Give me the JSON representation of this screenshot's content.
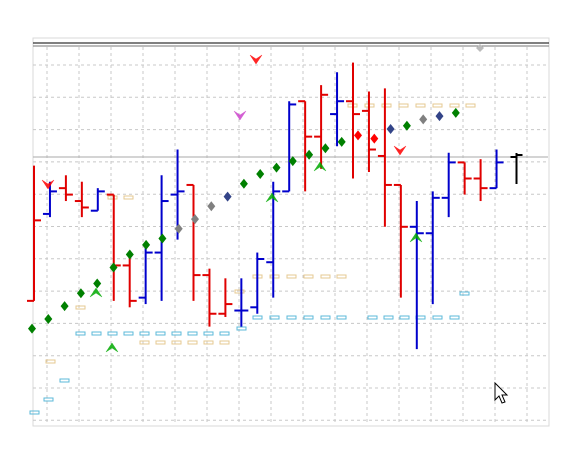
{
  "chart_data": {
    "type": "ohlc",
    "grid": true,
    "ylim": [
      0,
      100
    ],
    "x": [
      1,
      2,
      3,
      4,
      5,
      6,
      7,
      8,
      9,
      10,
      11,
      12,
      13,
      14,
      15,
      16,
      17,
      18,
      19,
      20,
      21,
      22,
      23,
      24,
      25,
      26,
      27,
      28,
      29,
      30
    ],
    "bars": [
      {
        "o": 37,
        "h": 79,
        "l": 62,
        "c": 62,
        "color": "red"
      },
      {
        "o": 64,
        "h": 74,
        "l": 63,
        "c": 71,
        "color": "blue"
      },
      {
        "o": 72,
        "h": 76,
        "l": 68,
        "c": 70,
        "color": "red"
      },
      {
        "o": 68,
        "h": 74,
        "l": 63,
        "c": 66,
        "color": "red"
      },
      {
        "o": 65,
        "h": 72,
        "l": 67,
        "c": 71,
        "color": "blue"
      },
      {
        "o": 70,
        "h": 68,
        "l": 37,
        "c": 48,
        "color": "red"
      },
      {
        "o": 48,
        "h": 52,
        "l": 35,
        "c": 37,
        "color": "red"
      },
      {
        "o": 38,
        "h": 54,
        "l": 36,
        "c": 52,
        "color": "blue"
      },
      {
        "o": 52,
        "h": 76,
        "l": 37,
        "c": 68,
        "color": "blue"
      },
      {
        "o": 70,
        "h": 84,
        "l": 56,
        "c": 71,
        "color": "blue"
      },
      {
        "o": 73,
        "h": 72,
        "l": 37,
        "c": 45,
        "color": "red"
      },
      {
        "o": 45,
        "h": 47,
        "l": 29,
        "c": 33,
        "color": "red"
      },
      {
        "o": 33,
        "h": 44,
        "l": 32,
        "c": 36,
        "color": "red"
      },
      {
        "o": 34,
        "h": 44,
        "l": 29,
        "c": 34,
        "color": "blue"
      },
      {
        "o": 35,
        "h": 52,
        "l": 33,
        "c": 50,
        "color": "blue"
      },
      {
        "o": 49,
        "h": 74,
        "l": 38,
        "c": 71,
        "color": "blue"
      },
      {
        "o": 71,
        "h": 99,
        "l": 74,
        "c": 98,
        "color": "blue"
      },
      {
        "o": 99,
        "h": 92,
        "l": 71,
        "c": 88,
        "color": "red"
      },
      {
        "o": 88,
        "h": 104,
        "l": 78,
        "c": 101,
        "color": "red"
      },
      {
        "o": 95,
        "h": 108,
        "l": 85,
        "c": 99,
        "color": "blue"
      },
      {
        "o": 99,
        "h": 111,
        "l": 75,
        "c": 95,
        "color": "red"
      },
      {
        "o": 96,
        "h": 102,
        "l": 77,
        "c": 84,
        "color": "red"
      },
      {
        "o": 82,
        "h": 103,
        "l": 60,
        "c": 73,
        "color": "red"
      },
      {
        "o": 73,
        "h": 68,
        "l": 38,
        "c": 60,
        "color": "red"
      },
      {
        "o": 60,
        "h": 68,
        "l": 22,
        "c": 58,
        "color": "blue"
      },
      {
        "o": 58,
        "h": 71,
        "l": 36,
        "c": 69,
        "color": "blue"
      },
      {
        "o": 69,
        "h": 83,
        "l": 63,
        "c": 80,
        "color": "blue"
      },
      {
        "o": 80,
        "h": 80,
        "l": 70,
        "c": 75,
        "color": "red"
      },
      {
        "o": 75,
        "h": 81,
        "l": 68,
        "c": 72,
        "color": "red"
      },
      {
        "o": 72,
        "h": 84,
        "l": 73,
        "c": 80,
        "color": "blue"
      }
    ],
    "sar": [
      {
        "v": 29,
        "color": "green"
      },
      {
        "v": 32,
        "color": "green"
      },
      {
        "v": 36,
        "color": "green"
      },
      {
        "v": 40,
        "color": "green"
      },
      {
        "v": 43,
        "color": "green"
      },
      {
        "v": 48,
        "color": "green"
      },
      {
        "v": 52,
        "color": "green"
      },
      {
        "v": 55,
        "color": "green"
      },
      {
        "v": 57,
        "color": "green"
      },
      {
        "v": 60,
        "color": "gray"
      },
      {
        "v": 63,
        "color": "gray"
      },
      {
        "v": 67,
        "color": "gray"
      },
      {
        "v": 70,
        "color": "navy"
      },
      {
        "v": 74,
        "color": "green"
      },
      {
        "v": 77,
        "color": "green"
      },
      {
        "v": 79,
        "color": "green"
      },
      {
        "v": 81,
        "color": "green"
      },
      {
        "v": 83,
        "color": "green"
      },
      {
        "v": 85,
        "color": "green"
      },
      {
        "v": 87,
        "color": "green"
      },
      {
        "v": 89,
        "color": "red"
      },
      {
        "v": 88,
        "color": "red"
      },
      {
        "v": 91,
        "color": "navy"
      },
      {
        "v": 92,
        "color": "green"
      },
      {
        "v": 94,
        "color": "gray"
      },
      {
        "v": 95,
        "color": "navy"
      },
      {
        "v": 96,
        "color": "green"
      }
    ],
    "colors": {
      "up": "#0000cc",
      "down": "#e00000",
      "last": "#000000",
      "sar_green": "#008000",
      "sar_gray": "#808080",
      "sar_navy": "#334488",
      "sar_red": "#ff0000",
      "grid": "#c8c8c8",
      "fractal_up": "#ff0000",
      "fractal_down": "#00aa00",
      "resistance_marker": "#e6c890",
      "support_marker": "#5bb8d8"
    }
  }
}
